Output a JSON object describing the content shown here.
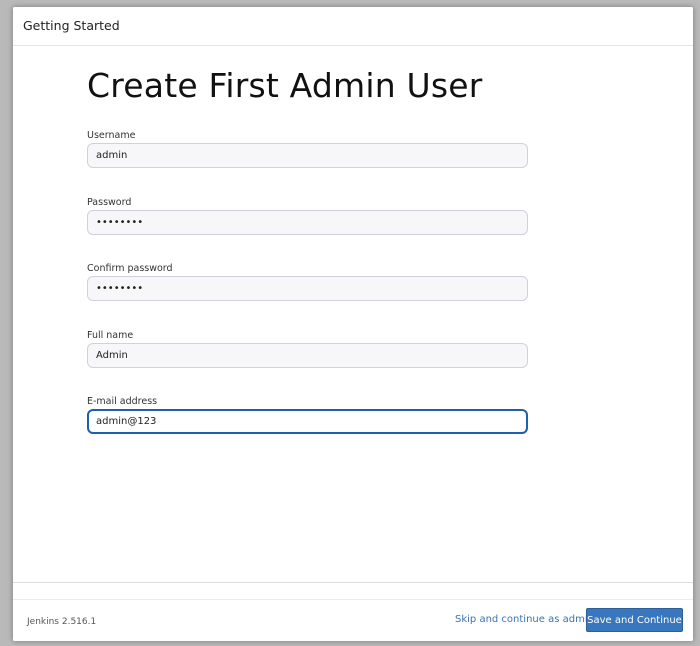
{
  "header": {
    "title": "Getting Started"
  },
  "main": {
    "title": "Create First Admin User",
    "fields": {
      "username": {
        "label": "Username",
        "value": "admin"
      },
      "password": {
        "label": "Password",
        "value": "password"
      },
      "confirm_password": {
        "label": "Confirm password",
        "value": "password"
      },
      "full_name": {
        "label": "Full name",
        "value": "Admin"
      },
      "email": {
        "label": "E-mail address",
        "value": "admin@123"
      }
    }
  },
  "footer": {
    "version": "Jenkins 2.516.1",
    "skip_label": "Skip and continue as admin",
    "save_label": "Save and Continue"
  },
  "colors": {
    "primary_button": "#3877bd",
    "link": "#3b73b3",
    "focus_border": "#1f5fb0"
  }
}
